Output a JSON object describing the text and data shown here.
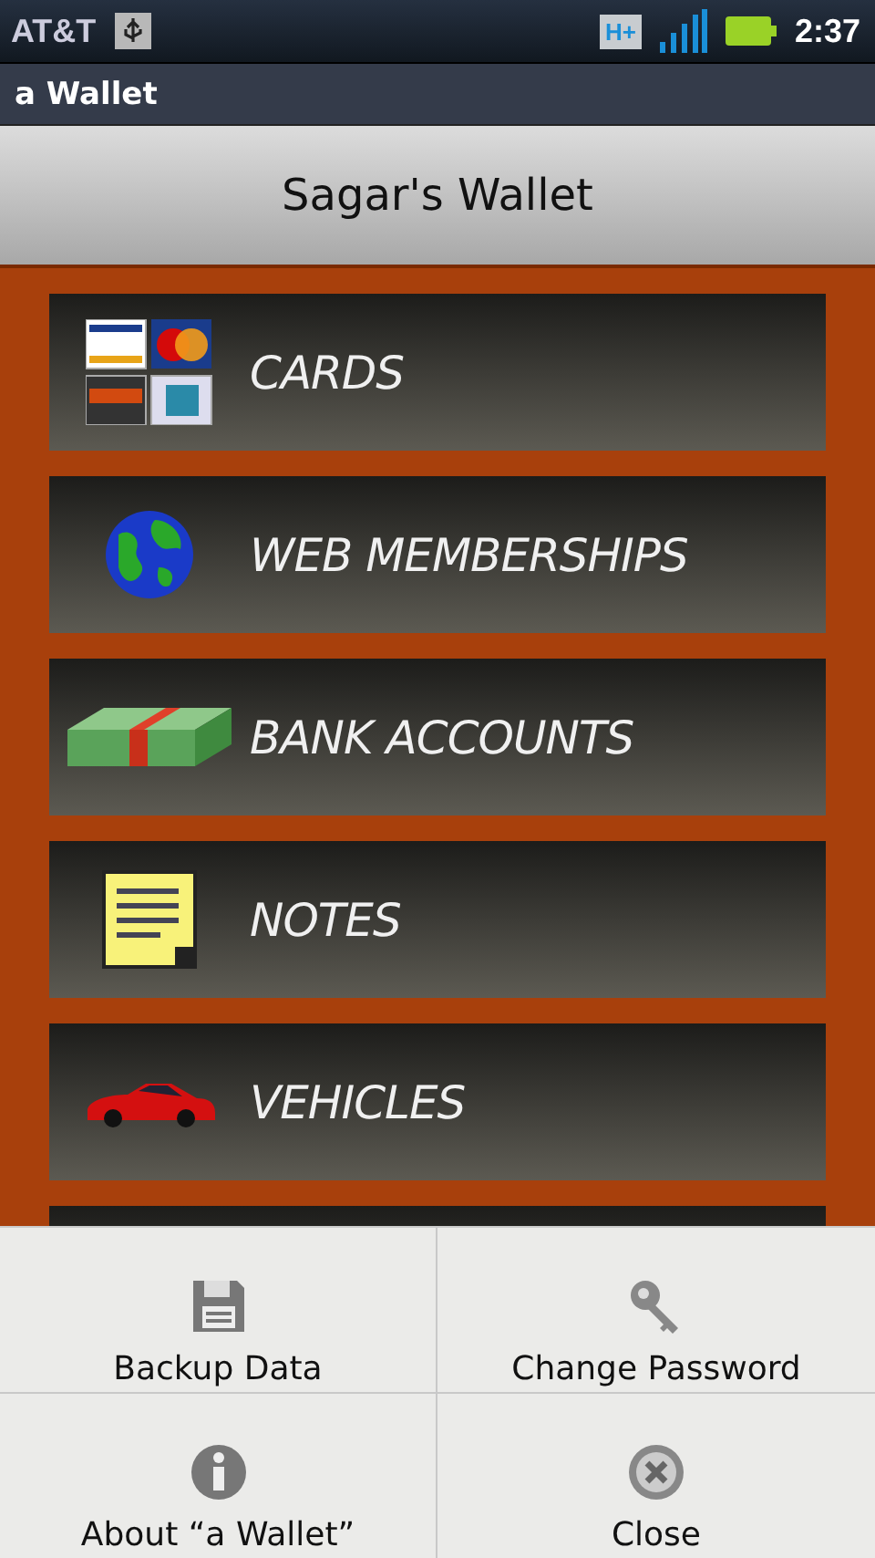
{
  "status_bar": {
    "carrier": "AT&T",
    "network": "H+",
    "time": "2:37"
  },
  "window": {
    "title": "a Wallet"
  },
  "header": {
    "title": "Sagar's Wallet"
  },
  "categories": [
    {
      "label": "CARDS"
    },
    {
      "label": "WEB MEMBERSHIPS"
    },
    {
      "label": "BANK ACCOUNTS"
    },
    {
      "label": "NOTES"
    },
    {
      "label": "VEHICLES"
    }
  ],
  "options_menu": [
    {
      "label": "Backup Data"
    },
    {
      "label": "Change Password"
    },
    {
      "label": "About “a Wallet”"
    },
    {
      "label": "Close"
    }
  ]
}
